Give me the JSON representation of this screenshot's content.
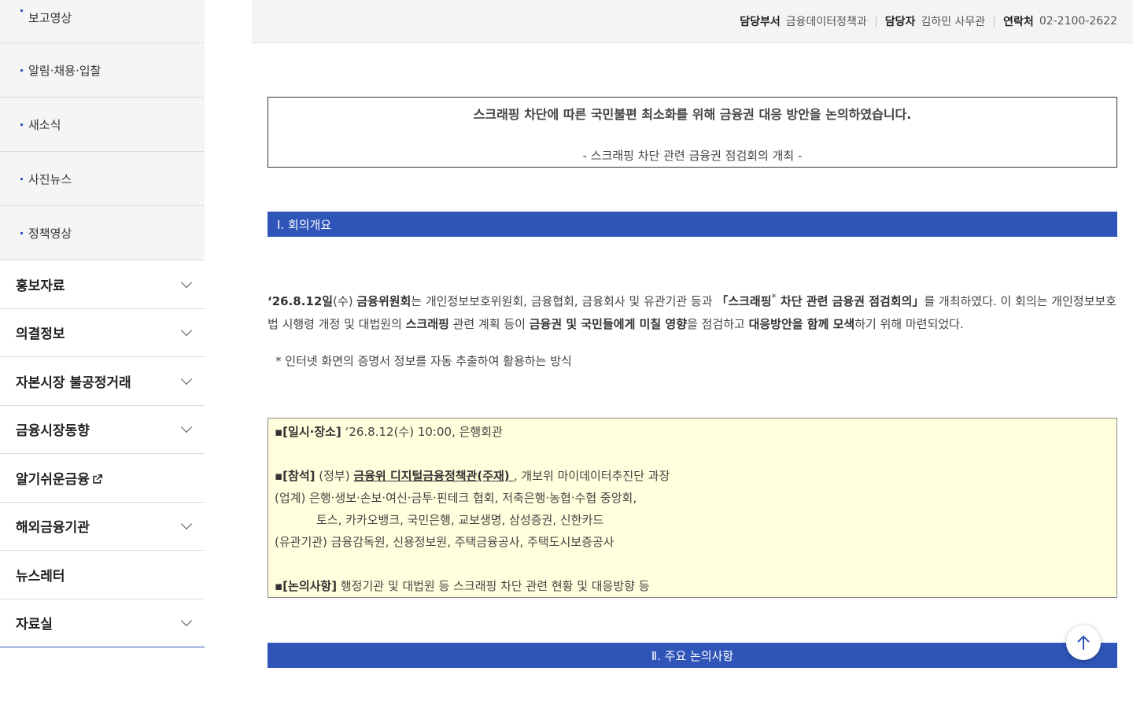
{
  "sidebar": {
    "sub_items": [
      "보고영상",
      "알림·채용·입찰",
      "새소식",
      "사진뉴스",
      "정책영상"
    ],
    "main_items": [
      {
        "label": "홍보자료",
        "icon": "chevron-down-icon"
      },
      {
        "label": "의결정보",
        "icon": "chevron-down-icon"
      },
      {
        "label": "자본시장 불공정거래",
        "icon": "chevron-down-icon"
      },
      {
        "label": "금융시장동향",
        "icon": "chevron-down-icon"
      },
      {
        "label": "알기쉬운금융",
        "icon": "external-link-icon"
      },
      {
        "label": "해외금융기관",
        "icon": "chevron-down-icon"
      },
      {
        "label": "뉴스레터",
        "icon": ""
      },
      {
        "label": "자료실",
        "icon": "chevron-down-icon"
      }
    ]
  },
  "infobar": {
    "dept_label": "담당부서",
    "dept_value": "금융데이터정책과",
    "person_label": "담당자",
    "person_value": "김하민 사무관",
    "contact_label": "연락처",
    "contact_value": "02-2100-2622"
  },
  "article": {
    "title": "스크래핑 차단에 따른 국민불편 최소화를 위해 금융권 대응 방안을 논의하였습니다.",
    "subtitle": "-  스크래핑 차단 관련 금융권 점검회의 개최 -",
    "section1": "Ⅰ. 회의개요",
    "para": {
      "p1": "‘26.8.12일",
      "p2": "(수) ",
      "p3": "금융위원회",
      "p4": "는 개인정보보호위원회, 금융협회, 금융회사 및 유관기관 등과 ",
      "p5": "「스크래핑",
      "p6": "*",
      "p7": " 차단 관련 금융권 점검회의」",
      "p8": "를 개최하였다. 이 회의는 개인정보보호법 시행령 개정 및 대법원의 ",
      "p9": "스크래핑",
      "p10": " 관련 계획 등이 ",
      "p11": "금융권 및 국민들에게 미칠 영향",
      "p12": "을 점검하고 ",
      "p13": "대응방안을 함께 모색",
      "p14": "하기 위해 마련되었다."
    },
    "note": "* 인터넷 화면의 증명서 정보를 자동 추출하여 활용하는 방식",
    "box": {
      "l1_label": "▪[일시·장소]",
      "l1_text": " ‘26.8.12(수) 10:00, 은행회관",
      "l2_label": "▪[참석]",
      "l2_a": " (정부) ",
      "l2_b": "금융위 디지털금융정책관(주재) ",
      "l2_c": ", 개보위 마이데이터추진단 과장",
      "l3": "(업계) 은행·생보·손보·여신·금투·핀테크 협회, 저축은행·농협·수협 중앙회,",
      "l4": "토스, 카카오뱅크, 국민은행, 교보생명, 삼성증권, 신한카드",
      "l5": "(유관기관) 금융감독원, 신용정보원, 주택금융공사, 주택도시보증공사",
      "l6_label": "▪[논의사항]",
      "l6_text": " 행정기관 및 대법원 등 스크래핑 차단 관련 현황 및 대응방향 등"
    },
    "section2": "Ⅱ. 주요 논의사항"
  },
  "colors": {
    "accent": "#2f55b8",
    "box_bg": "#ffffdd"
  }
}
